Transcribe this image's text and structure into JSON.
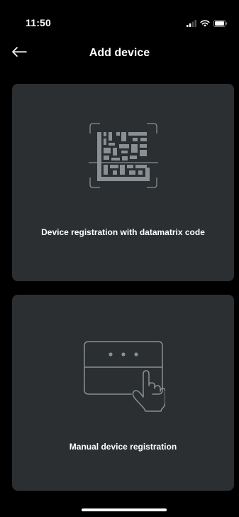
{
  "status_bar": {
    "time": "11:50",
    "icons": [
      "signal-icon",
      "wifi-icon",
      "battery-icon"
    ]
  },
  "header": {
    "back_icon": "arrow-left-icon",
    "title": "Add device"
  },
  "options": [
    {
      "icon": "datamatrix-scan-icon",
      "label": "Device registration with datamatrix code"
    },
    {
      "icon": "keypad-touch-icon",
      "label": "Manual device registration"
    }
  ],
  "colors": {
    "background": "#000000",
    "card": "#2b2f31",
    "icon": "#8a8f93",
    "text": "#ffffff"
  }
}
